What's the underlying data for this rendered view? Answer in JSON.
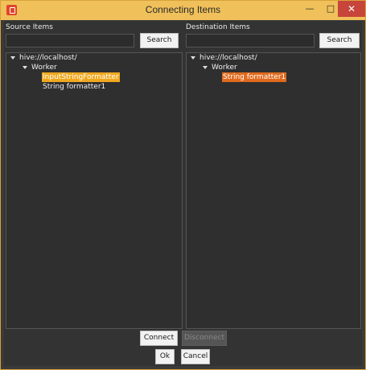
{
  "window": {
    "title": "Connecting Items",
    "controls": {
      "minimize": "—",
      "maximize": "□",
      "close": "✕"
    }
  },
  "source": {
    "label": "Source Items",
    "search": {
      "value": "",
      "placeholder": "",
      "button": "Search"
    },
    "tree": {
      "root": "hive://localhost/",
      "group": "Worker",
      "items": [
        "InputStringFormatter",
        "String formatter1"
      ],
      "selected": "InputStringFormatter"
    }
  },
  "destination": {
    "label": "Destination Items",
    "search": {
      "value": "",
      "placeholder": "",
      "button": "Search"
    },
    "tree": {
      "root": "hive://localhost/",
      "group": "Worker",
      "items": [
        "String formatter1"
      ],
      "selected": "String formatter1"
    }
  },
  "actions": {
    "connect": "Connect",
    "disconnect": "Disconnect",
    "ok": "Ok",
    "cancel": "Cancel"
  },
  "colors": {
    "titlebar": "#f0c05a",
    "close": "#c7453a",
    "source_highlight": "#f0a820",
    "destination_highlight": "#e06a1e"
  }
}
